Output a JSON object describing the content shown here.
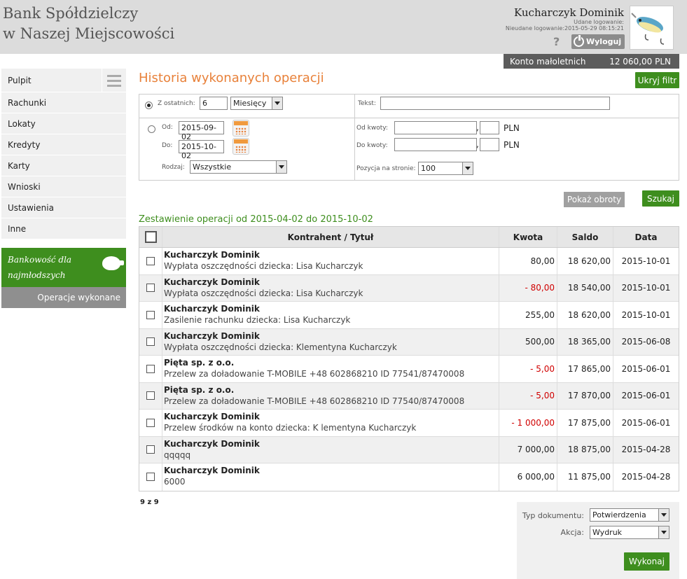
{
  "header": {
    "bank_line1": "Bank Spółdzielczy",
    "bank_line2": "w Naszej Miejscowości",
    "user_name": "Kucharczyk Dominik",
    "last_login": "Udane logowanie:",
    "failed_login": "Nieudane logowanie:2015-05-29 08:15:21",
    "help": "?",
    "logout_label": "Wyloguj",
    "account_name": "Konto małoletnich",
    "account_balance": "12 060,00 PLN"
  },
  "sidebar": {
    "items": [
      {
        "label": "Pulpit"
      },
      {
        "label": "Rachunki"
      },
      {
        "label": "Lokaty"
      },
      {
        "label": "Kredyty"
      },
      {
        "label": "Karty"
      },
      {
        "label": "Wnioski"
      },
      {
        "label": "Ustawienia"
      },
      {
        "label": "Inne"
      }
    ],
    "promo_line1": "Bankowość dla",
    "promo_line2": "najmłodszych",
    "active_sub": "Operacje wykonane"
  },
  "main": {
    "title": "Historia wykonanych operacji",
    "hide_filter": "Ukryj filtr",
    "filter": {
      "last_label": "Z ostatnich:",
      "last_value": "6",
      "last_unit": "Miesięcy",
      "text_label": "Tekst:",
      "text_value": "",
      "from_label": "Od:",
      "from_value": "2015-09-02",
      "to_label": "Do:",
      "to_value": "2015-10-02",
      "amount_from_label": "Od kwoty:",
      "amount_to_label": "Do kwoty:",
      "comma": ",",
      "currency": "PLN",
      "type_label": "Rodzaj:",
      "type_value": "Wszystkie",
      "per_page_label": "Pozycja na stronie:",
      "per_page_value": "100"
    },
    "show_turnover": "Pokaż obroty",
    "search": "Szukaj",
    "summary": "Zestawienie operacji od 2015-04-02 do 2015-10-02",
    "columns": {
      "title": "Kontrahent / Tytuł",
      "amount": "Kwota",
      "balance": "Saldo",
      "date": "Data"
    },
    "rows": [
      {
        "name": "Kucharczyk Dominik",
        "desc": "Wypłata oszczędności dziecka: Lisa Kucharczyk",
        "amount": "80,00",
        "balance": "18 620,00",
        "date": "2015-10-01"
      },
      {
        "name": "Kucharczyk Dominik",
        "desc": "Wypłata oszczędności dziecka: Lisa Kucharczyk",
        "amount": "- 80,00",
        "balance": "18 540,00",
        "date": "2015-10-01"
      },
      {
        "name": "Kucharczyk Dominik",
        "desc": "Zasilenie rachunku dziecka: Lisa Kucharczyk",
        "amount": "255,00",
        "balance": "18 620,00",
        "date": "2015-10-01"
      },
      {
        "name": "Kucharczyk Dominik",
        "desc": "Wypłata oszczędności dziecka: Klementyna Kucharczyk",
        "amount": "500,00",
        "balance": "18 365,00",
        "date": "2015-06-08"
      },
      {
        "name": "Pięta sp. z o.o.",
        "desc": "Przelew za doładowanie T-MOBILE +48 602868210 ID 77541/87470008",
        "amount": "- 5,00",
        "balance": "17 865,00",
        "date": "2015-06-01"
      },
      {
        "name": "Pięta sp. z o.o.",
        "desc": "Przelew za doładowanie T-MOBILE +48 602868210 ID 77540/87470008",
        "amount": "- 5,00",
        "balance": "17 870,00",
        "date": "2015-06-01"
      },
      {
        "name": "Kucharczyk Dominik",
        "desc": "Przelew środków na konto dziecka: K lementyna Kucharczyk",
        "amount": "- 1 000,00",
        "balance": "17 875,00",
        "date": "2015-06-01"
      },
      {
        "name": "Kucharczyk Dominik",
        "desc": "qqqqq",
        "amount": "7 000,00",
        "balance": "18 875,00",
        "date": "2015-04-28"
      },
      {
        "name": "Kucharczyk Dominik",
        "desc": "6000",
        "amount": "6 000,00",
        "balance": "11 875,00",
        "date": "2015-04-28"
      }
    ],
    "pager": "9 z 9",
    "doc": {
      "type_label": "Typ dokumentu:",
      "type_value": "Potwierdzenia",
      "action_label": "Akcja:",
      "action_value": "Wydruk",
      "execute": "Wykonaj"
    }
  },
  "colors": {
    "accent_green": "#3e8e1e",
    "title_orange": "#e8813a",
    "negative_red": "#d00000"
  }
}
